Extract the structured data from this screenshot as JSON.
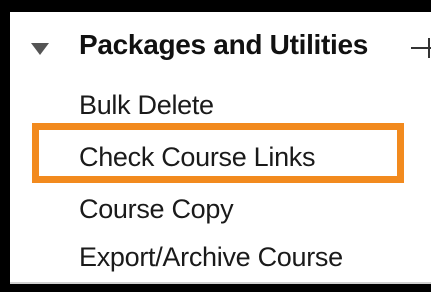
{
  "panel": {
    "header": {
      "label": "Packages and Utilities",
      "expand_icon": "triangle-down-icon",
      "end_icon": "arrow-right-icon"
    },
    "items": [
      {
        "label": "Bulk Delete"
      },
      {
        "label": "Check Course Links"
      },
      {
        "label": "Course Copy"
      },
      {
        "label": "Export/Archive Course"
      }
    ],
    "highlight_color": "#f28a1e"
  }
}
